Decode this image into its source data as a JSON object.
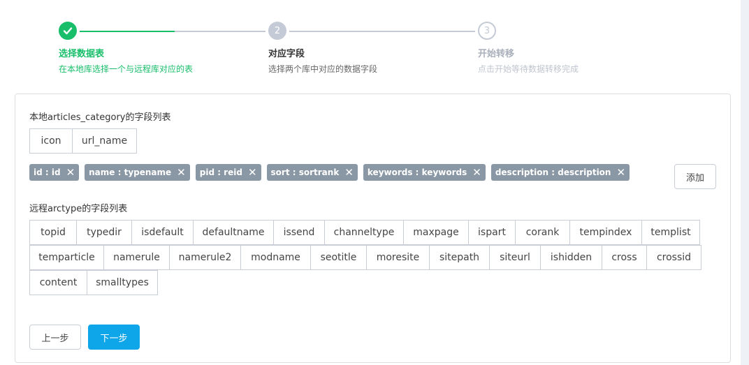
{
  "steps": [
    {
      "title": "选择数据表",
      "desc": "在本地库选择一个与远程库对应的表",
      "status": "done",
      "icon": "check-icon"
    },
    {
      "title": "对应字段",
      "desc": "选择两个库中对应的数据字段",
      "status": "active",
      "number": "2"
    },
    {
      "title": "开始转移",
      "desc": "点击开始等待数据转移完成",
      "status": "wait",
      "number": "3"
    }
  ],
  "local": {
    "label": "本地articles_category的字段列表",
    "fields": [
      "icon",
      "url_name"
    ]
  },
  "mappings": [
    "id : id",
    "name : typename",
    "pid : reid",
    "sort : sortrank",
    "keywords : keywords",
    "description : description"
  ],
  "add_label": "添加",
  "remote": {
    "label": "远程arctype的字段列表",
    "rows": [
      [
        "topid",
        "typedir",
        "isdefault",
        "defaultname",
        "issend",
        "channeltype",
        "maxpage",
        "ispart",
        "corank",
        "tempindex",
        "templist"
      ],
      [
        "temparticle",
        "namerule",
        "namerule2",
        "modname",
        "seotitle",
        "moresite",
        "sitepath",
        "siteurl",
        "ishidden",
        "cross",
        "crossid"
      ],
      [
        "content",
        "smalltypes"
      ]
    ]
  },
  "prev_label": "上一步",
  "next_label": "下一步",
  "colors": {
    "success": "#19be6b",
    "primary": "#0ea5e9",
    "tag": "#8a97a4",
    "inactive": "#c5cbd6"
  }
}
